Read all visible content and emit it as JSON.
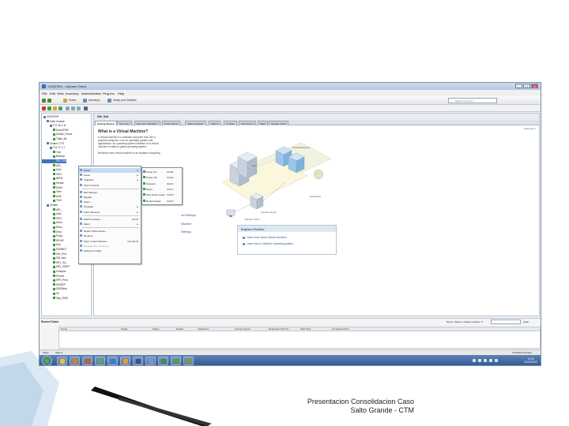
{
  "window": {
    "title": "VCENTER - vSphere Client",
    "buttons": [
      "_",
      "□",
      "X"
    ]
  },
  "menubar": [
    "File",
    "Edit",
    "View",
    "Inventory",
    "Administration",
    "Plug-ins",
    "Help"
  ],
  "toolbar": {
    "home": "Home",
    "inventory": "Inventory",
    "hosts_clusters": "Hosts and Clusters",
    "search_placeholder": "Search Inventory"
  },
  "tree": {
    "items": [
      {
        "label": "VCENTER",
        "kind": "host",
        "indent": 0
      },
      {
        "label": "Salto Grande",
        "kind": "host",
        "indent": 1
      },
      {
        "label": "172.16.1.11",
        "kind": "host",
        "indent": 2
      },
      {
        "label": "DeAct7050",
        "kind": "vm",
        "indent": 3
      },
      {
        "label": "Dmbar_Ponce",
        "kind": "vm",
        "indent": 3
      },
      {
        "label": "Trafic_Bk",
        "kind": "vm",
        "indent": 3
      },
      {
        "label": "Cluster 1770",
        "kind": "host",
        "indent": 1
      },
      {
        "label": "172.17.1.1",
        "kind": "host",
        "indent": 2
      },
      {
        "label": "Txnt",
        "kind": "vm",
        "indent": 3
      },
      {
        "label": "BackUp",
        "kind": "vm",
        "indent": 3
      },
      {
        "label": "DW_Sob",
        "kind": "vm",
        "indent": 3,
        "selected": true
      },
      {
        "label": "APL_",
        "kind": "vm",
        "indent": 3
      },
      {
        "label": "Actri",
        "kind": "vm",
        "indent": 3
      },
      {
        "label": "SSCI",
        "kind": "vm",
        "indent": 3
      },
      {
        "label": "BEDE",
        "kind": "vm",
        "indent": 3
      },
      {
        "label": "Dmbar",
        "kind": "vm",
        "indent": 3
      },
      {
        "label": "Dmbr",
        "kind": "vm",
        "indent": 3
      },
      {
        "label": "Terrn",
        "kind": "vm",
        "indent": 3
      },
      {
        "label": "Unifi",
        "kind": "vm",
        "indent": 3
      },
      {
        "label": "TrCfl",
        "kind": "vm",
        "indent": 3
      },
      {
        "label": "Cluster",
        "kind": "host",
        "indent": 1
      },
      {
        "label": "APL_",
        "kind": "vm",
        "indent": 3
      },
      {
        "label": "Actri",
        "kind": "vm",
        "indent": 3
      },
      {
        "label": "SSCI",
        "kind": "vm",
        "indent": 3
      },
      {
        "label": "Dmbr",
        "kind": "vm",
        "indent": 3
      },
      {
        "label": "Desa",
        "kind": "vm",
        "indent": 3
      },
      {
        "label": "Dmp",
        "kind": "vm",
        "indent": 3
      },
      {
        "label": "Progr",
        "kind": "vm",
        "indent": 3
      },
      {
        "label": "DRIVE",
        "kind": "vm",
        "indent": 3
      },
      {
        "label": "Dep",
        "kind": "vm",
        "indent": 3
      },
      {
        "label": "ESMNET",
        "kind": "vm",
        "indent": 3
      },
      {
        "label": "ISA_Prnt",
        "kind": "vm",
        "indent": 3
      },
      {
        "label": "ISA_tard",
        "kind": "vm",
        "indent": 3
      },
      {
        "label": "MFL_SQ",
        "kind": "vm",
        "indent": 3
      },
      {
        "label": "MPL_IMSFT",
        "kind": "vm",
        "indent": 3
      },
      {
        "label": "Scanplot",
        "kind": "vm",
        "indent": 3
      },
      {
        "label": "Promis",
        "kind": "vm",
        "indent": 3
      },
      {
        "label": "SPS_Prna",
        "kind": "vm",
        "indent": 3
      },
      {
        "label": "SSISRP",
        "kind": "vm",
        "indent": 3
      },
      {
        "label": "SSISWeb",
        "kind": "vm",
        "indent": 3
      },
      {
        "label": "Sil",
        "kind": "vm",
        "indent": 3
      },
      {
        "label": "Sttp_SIGE",
        "kind": "vm",
        "indent": 3
      }
    ]
  },
  "main": {
    "vm_name": "DW_Sob",
    "close_tab": "close tab ✕",
    "tabs": [
      "Getting Started",
      "Summary",
      "Resource Allocation",
      "Performance",
      "Tasks & Events",
      "Alarms",
      "Console",
      "Permissions",
      "Maps",
      "Storage Views"
    ],
    "heading": "What is a Virtual Machine?",
    "paragraphs": [
      "A virtual machine is a software computer that, like a",
      "physical computer, runs an operating system and",
      "applications. An operating system installed on a virtual",
      "machine is called a guest operating system.",
      "Because every virtual machine is an isolated computing"
    ],
    "partial_links": [
      "ver Settings",
      "Machine",
      "Settings"
    ],
    "diagram_labels": [
      "Virtual Machines",
      "Host",
      "Datacenter",
      "vCenter Server",
      "vSphere Client"
    ],
    "explore": {
      "title": "Explore Further",
      "items": [
        "Learn more about virtual machines",
        "Learn how to install an operating system"
      ]
    }
  },
  "context_menu": {
    "items": [
      {
        "label": "Power",
        "submenu": true,
        "highlight": true
      },
      {
        "label": "Guest",
        "submenu": true
      },
      {
        "label": "Snapshot",
        "submenu": true
      },
      {
        "label": "Open Console"
      },
      {
        "sep": true
      },
      {
        "label": "Edit Settings..."
      },
      {
        "label": "Migrate..."
      },
      {
        "label": "Clone..."
      },
      {
        "label": "Template",
        "submenu": true
      },
      {
        "label": "Fault Tolerance",
        "submenu": true
      },
      {
        "sep": true
      },
      {
        "label": "Add Permission...",
        "shortcut": "Ctrl+P"
      },
      {
        "label": "Alarm",
        "submenu": true
      },
      {
        "sep": true
      },
      {
        "label": "Report Performance..."
      },
      {
        "label": "Rename"
      },
      {
        "label": "Open in New Window...",
        "shortcut": "Ctrl+Alt+N"
      },
      {
        "label": "Remove from Inventory",
        "disabled": true
      },
      {
        "label": "Delete from Disk"
      }
    ]
  },
  "submenu": {
    "items": [
      {
        "label": "Power On",
        "shortcut": "Ctrl+B"
      },
      {
        "label": "Power Off",
        "shortcut": "Ctrl+E"
      },
      {
        "label": "Suspend",
        "shortcut": "Ctrl+Z"
      },
      {
        "label": "Reset",
        "shortcut": "Ctrl+T"
      },
      {
        "label": "Shut Down Guest",
        "shortcut": "Ctrl+D"
      },
      {
        "label": "Restart Guest",
        "shortcut": "Ctrl+R"
      }
    ]
  },
  "tasks": {
    "title": "Recent Tasks",
    "filter_label": "Name, Target or Status contains: ▾",
    "clear": "Clear",
    "columns": [
      "Name",
      "Target",
      "Status",
      "Details",
      "Initiated by",
      "vCenter Server",
      "Requested Start Ti...",
      "Start Time",
      "Completed Time"
    ]
  },
  "statusbar": {
    "left": [
      "Tasks",
      "Alarms"
    ],
    "right": "CTM\\Administrator"
  },
  "taskbar": {
    "time": "12:00",
    "date": "31/01/2012"
  },
  "caption": {
    "line1": "Presentacion Consolidacion Caso",
    "line2": "Salto Grande - CTM"
  },
  "colors": {
    "accent": "#3d72c4",
    "taskbar": "#2f5590",
    "slide_stripe": "#8fb3d6"
  }
}
